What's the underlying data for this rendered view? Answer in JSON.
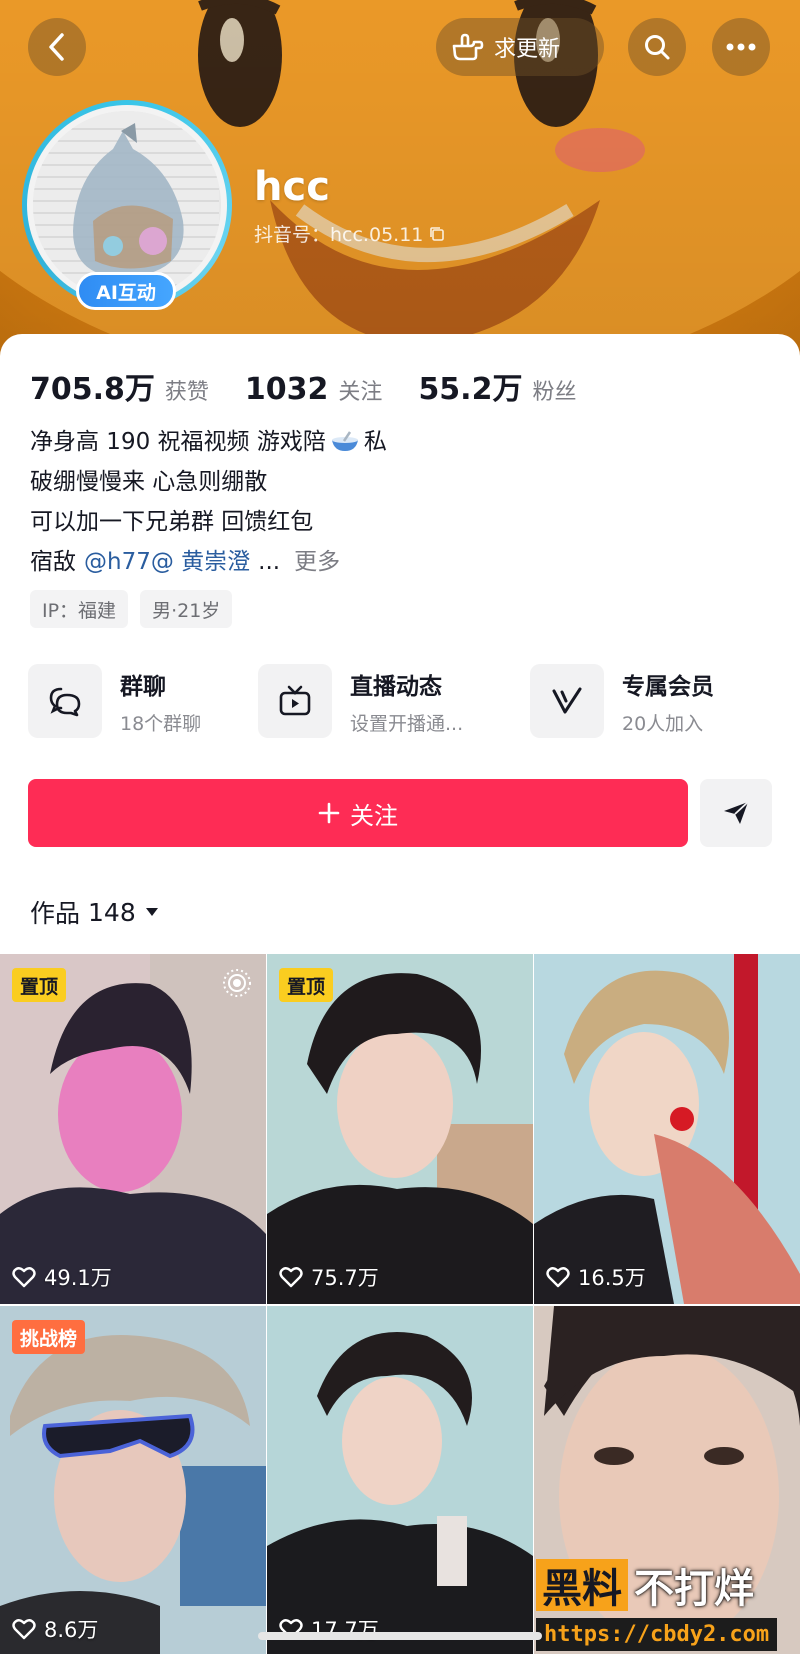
{
  "header": {
    "update_label": "求更新"
  },
  "profile": {
    "username": "hcc",
    "douyin_id": "抖音号：hcc.05.11",
    "ai_badge": "AI互动"
  },
  "stats": [
    {
      "num": "705.8万",
      "label": "获赞"
    },
    {
      "num": "1032",
      "label": "关注"
    },
    {
      "num": "55.2万",
      "label": "粉丝"
    }
  ],
  "bio": {
    "line1_a": "净身高 190 祝福视频  游戏陪",
    "line1_b": "私",
    "line2": "破绷慢慢来 心急则绷散",
    "line3": "可以加一下兄弟群 回馈红包",
    "line4_a": "宿敌",
    "line4_mention": "@h77@ 黄崇澄",
    "line4_ellipsis": "...",
    "more": "更多"
  },
  "tags": [
    "IP：福建",
    "男·21岁"
  ],
  "features": [
    {
      "title": "群聊",
      "sub": "18个群聊"
    },
    {
      "title": "直播动态",
      "sub": "设置开播通..."
    },
    {
      "title": "专属会员",
      "sub": "20人加入"
    }
  ],
  "follow_label": "关注",
  "works": {
    "label": "作品",
    "count": "148"
  },
  "tiles": [
    {
      "badge": "置顶",
      "likes": "49.1万"
    },
    {
      "badge": "置顶",
      "likes": "75.7万"
    },
    {
      "badge": "",
      "likes": "16.5万"
    },
    {
      "badge": "挑战榜",
      "likes": "8.6万"
    },
    {
      "badge": "",
      "likes": "17.7万"
    },
    {
      "badge": "",
      "likes": ""
    }
  ],
  "watermark": {
    "a": "黑料",
    "b": "不打烊",
    "url": "https://cbdy2.com"
  },
  "colors": {
    "accent": "#fe2c55",
    "pin_badge": "#facd20",
    "challenge_badge": "#ff6e40",
    "mention": "#2a5d9f"
  }
}
